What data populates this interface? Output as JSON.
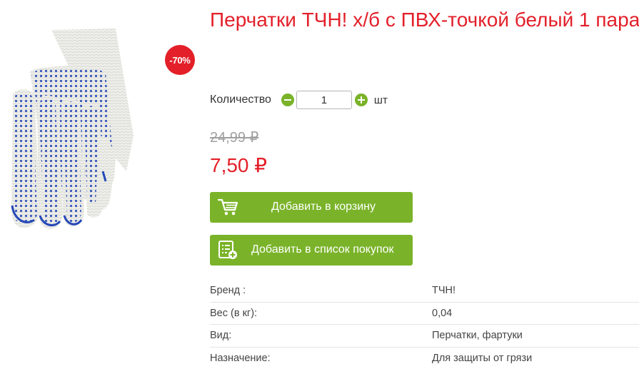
{
  "product": {
    "title": "Перчатки ТЧН! х/б с ПВХ-точкой белый 1 пара",
    "discount_badge": "-70%",
    "image_icon": "glove-photo"
  },
  "quantity": {
    "label": "Количество",
    "value": "1",
    "unit": "шт"
  },
  "price": {
    "old": "24,99 ₽",
    "new": "7,50 ₽"
  },
  "actions": {
    "add_to_cart": "Добавить в корзину",
    "add_to_list": "Добавить в список покупок"
  },
  "specs": [
    {
      "name": "Бренд :",
      "value": "ТЧН!"
    },
    {
      "name": "Вес (в кг):",
      "value": "0,04"
    },
    {
      "name": "Вид:",
      "value": "Перчатки, фартуки"
    },
    {
      "name": "Назначение:",
      "value": "Для защиты от грязи"
    }
  ],
  "colors": {
    "accent_red": "#e3202a",
    "accent_green": "#7ab329",
    "glove_dots": "#2448b8"
  }
}
